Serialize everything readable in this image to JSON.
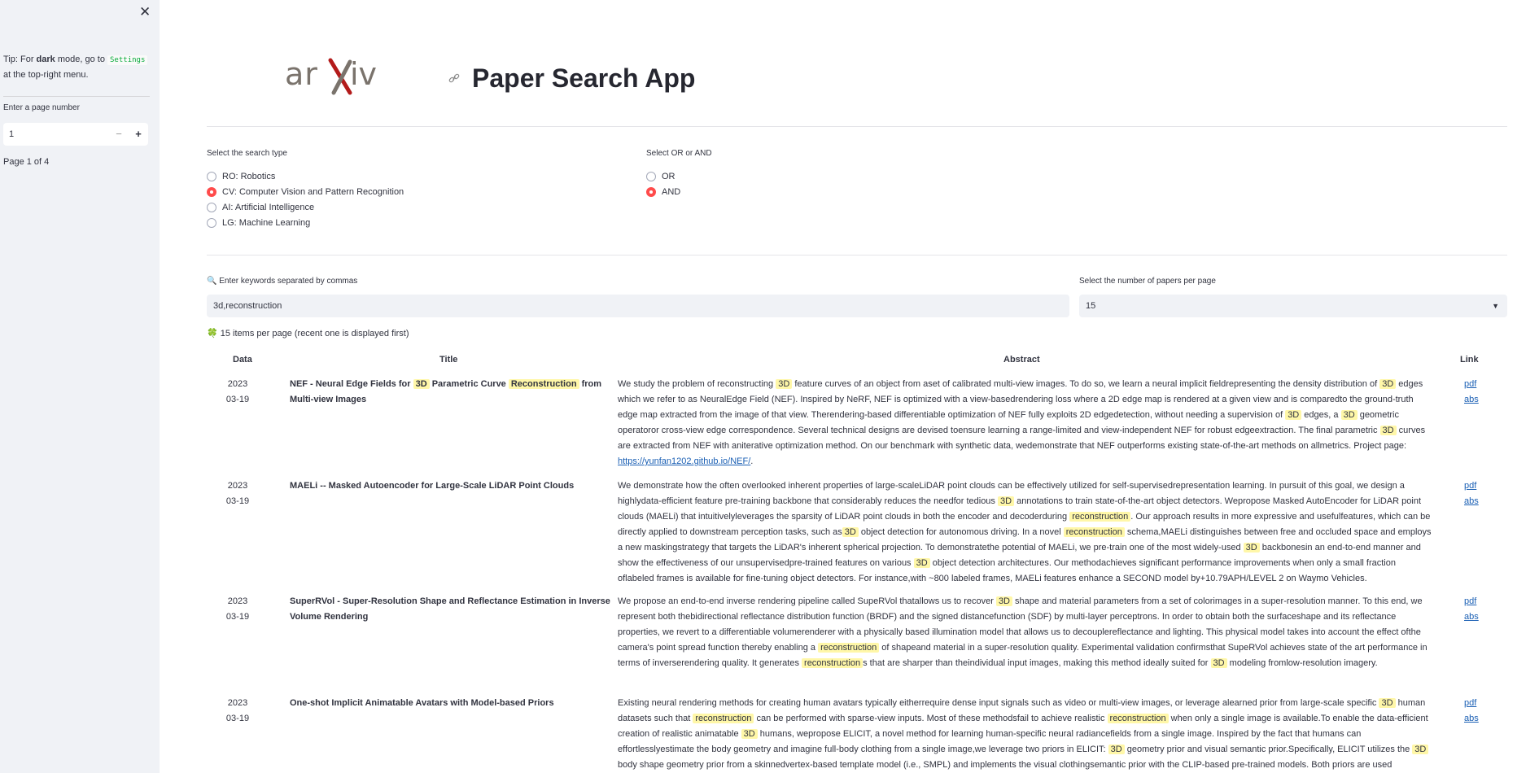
{
  "sidebar": {
    "close_glyph": "✕",
    "tip_prefix": "Tip: For ",
    "tip_bold": "dark",
    "tip_mid": " mode, go to ",
    "tip_code": "Settings",
    "tip_suffix": " at the top-right menu.",
    "page_label": "Enter a page number",
    "page_value": "1",
    "minus": "−",
    "plus": "+",
    "page_status": "Page 1 of 4"
  },
  "header": {
    "logo_text": "arXiv",
    "title": "Paper Search App"
  },
  "search_type": {
    "label": "Select the search type",
    "options": [
      "RO: Robotics",
      "CV: Computer Vision and Pattern Recognition",
      "AI: Artificial Intelligence",
      "LG: Machine Learning"
    ],
    "selected": "CV: Computer Vision and Pattern Recognition"
  },
  "logic": {
    "label": "Select OR or AND",
    "options": [
      "OR",
      "AND"
    ],
    "selected": "AND"
  },
  "keywords": {
    "label": "🔍 Enter keywords separated by commas",
    "value": "3d,reconstruction"
  },
  "per_page": {
    "label": "Select the number of papers per page",
    "value": "15"
  },
  "items_info": "🍀 15 items per page (recent one is displayed first)",
  "table": {
    "headers": {
      "date": "Data",
      "title": "Title",
      "abstract": "Abstract",
      "link": "Link"
    },
    "rows": [
      {
        "date_year": "2023",
        "date_md": "03-19",
        "title": [
          {
            "t": "NEF - Neural Edge Fields for "
          },
          {
            "t": "3D",
            "hl": true
          },
          {
            "t": " Parametric Curve "
          },
          {
            "t": "Reconstruction",
            "hl": true
          },
          {
            "t": " from Multi-view Images"
          }
        ],
        "abstract": [
          {
            "t": "We study the problem of reconstructing "
          },
          {
            "t": "3D",
            "hl": true
          },
          {
            "t": " feature curves of an object from aset of calibrated multi-view images. To do so, we learn a neural implicit fieldrepresenting the density distribution of "
          },
          {
            "t": "3D",
            "hl": true
          },
          {
            "t": " edges which we refer to as NeuralEdge Field (NEF). Inspired by NeRF, NEF is optimized with a view-basedrendering loss where a 2D edge map is rendered at a given view and is comparedto the ground-truth edge map extracted from the image of that view. Therendering-based differentiable optimization of NEF fully exploits 2D edgedetection, without needing a supervision of "
          },
          {
            "t": "3D",
            "hl": true
          },
          {
            "t": " edges, a "
          },
          {
            "t": "3D",
            "hl": true
          },
          {
            "t": " geometric operatoror cross-view edge correspondence. Several technical designs are devised toensure learning a range-limited and view-independent NEF for robust edgeextraction. The final parametric "
          },
          {
            "t": "3D",
            "hl": true
          },
          {
            "t": " curves are extracted from NEF with aniterative optimization method. On our benchmark with synthetic data, wedemonstrate that NEF outperforms existing state-of-the-art methods on allmetrics. Project page: "
          },
          {
            "t": "https://yunfan1202.github.io/NEF/",
            "url": true
          },
          {
            "t": "."
          }
        ],
        "pdf": "pdf",
        "abs": "abs"
      },
      {
        "date_year": "2023",
        "date_md": "03-19",
        "title": [
          {
            "t": "MAELi -- Masked Autoencoder for Large-Scale LiDAR Point Clouds"
          }
        ],
        "abstract": [
          {
            "t": "We demonstrate how the often overlooked inherent properties of large-scaleLiDAR point clouds can be effectively utilized for self-supervisedrepresentation learning. In pursuit of this goal, we design a highlydata-efficient feature pre-training backbone that considerably reduces the needfor tedious "
          },
          {
            "t": "3D",
            "hl": true
          },
          {
            "t": " annotations to train state-of-the-art object detectors. Wepropose Masked AutoEncoder for LiDAR point clouds (MAELi) that intuitivelyleverages the sparsity of LiDAR point clouds in both the encoder and decoderduring "
          },
          {
            "t": "reconstruction",
            "hl": true
          },
          {
            "t": ". Our approach results in more expressive and usefulfeatures, which can be directly applied to downstream perception tasks, such as"
          },
          {
            "t": "3D",
            "hl": true
          },
          {
            "t": " object detection for autonomous driving. In a novel "
          },
          {
            "t": "reconstruction",
            "hl": true
          },
          {
            "t": " schema,MAELi distinguishes between free and occluded space and employs a new maskingstrategy that targets the LiDAR's inherent spherical projection. To demonstratethe potential of MAELi, we pre-train one of the most widely-used "
          },
          {
            "t": "3D",
            "hl": true
          },
          {
            "t": " backbonesin an end-to-end manner and show the effectiveness of our unsupervisedpre-trained features on various "
          },
          {
            "t": "3D",
            "hl": true
          },
          {
            "t": " object detection architectures. Our methodachieves significant performance improvements when only a small fraction oflabeled frames is available for fine-tuning object detectors. For instance,with ~800 labeled frames, MAELi features enhance a SECOND model by+10.79APH/LEVEL 2 on Waymo Vehicles."
          }
        ],
        "pdf": "pdf",
        "abs": "abs"
      },
      {
        "date_year": "2023",
        "date_md": "03-19",
        "title": [
          {
            "t": "SuperRVol - Super-Resolution Shape and Reflectance Estimation in Inverse Volume Rendering"
          }
        ],
        "abstract": [
          {
            "t": "We propose an end-to-end inverse rendering pipeline called SupeRVol thatallows us to recover "
          },
          {
            "t": "3D",
            "hl": true
          },
          {
            "t": " shape and material parameters from a set of colorimages in a super-resolution manner. To this end, we represent both thebidirectional reflectance distribution function (BRDF) and the signed distancefunction (SDF) by multi-layer perceptrons. In order to obtain both the surfaceshape and its reflectance properties, we revert to a differentiable volumerenderer with a physically based illumination model that allows us to decouplereflectance and lighting. This physical model takes into account the effect ofthe camera's point spread function thereby enabling a "
          },
          {
            "t": "reconstruction",
            "hl": true
          },
          {
            "t": " of shapeand material in a super-resolution quality. Experimental validation confirmsthat SupeRVol achieves state of the art performance in terms of inverserendering quality. It generates "
          },
          {
            "t": "reconstruction",
            "hl": true
          },
          {
            "t": "s that are sharper than theindividual input images, making this method ideally suited for "
          },
          {
            "t": "3D",
            "hl": true
          },
          {
            "t": " modeling fromlow-resolution imagery."
          }
        ],
        "pdf": "pdf",
        "abs": "abs"
      },
      {
        "date_year": "2023",
        "date_md": "03-19",
        "title": [
          {
            "t": "One-shot Implicit Animatable Avatars with Model-based Priors"
          }
        ],
        "abstract": [
          {
            "t": "Existing neural rendering methods for creating human avatars typically eitherrequire dense input signals such as video or multi-view images, or leverage alearned prior from large-scale specific "
          },
          {
            "t": "3D",
            "hl": true
          },
          {
            "t": " human datasets such that "
          },
          {
            "t": "reconstruction",
            "hl": true
          },
          {
            "t": " can be performed with sparse-view inputs. Most of these methodsfail to achieve realistic "
          },
          {
            "t": "reconstruction",
            "hl": true
          },
          {
            "t": " when only a single image is available.To enable the data-efficient creation of realistic animatable "
          },
          {
            "t": "3D",
            "hl": true
          },
          {
            "t": " humans, wepropose ELICIT, a novel method for learning human-specific neural radiancefields from a single image. Inspired by the fact that humans can effortlesslyestimate the body geometry and imagine full-body clothing from a single image,we leverage two priors in ELICIT: "
          },
          {
            "t": "3D",
            "hl": true
          },
          {
            "t": " geometry prior and visual semantic prior.Specifically, ELICIT utilizes the "
          },
          {
            "t": "3D",
            "hl": true
          },
          {
            "t": " body shape geometry prior from a skinnedvertex-based template model (i.e., SMPL) and implements the visual clothingsemantic prior with the CLIP-based pre-trained models. Both priors are used"
          }
        ],
        "pdf": "pdf",
        "abs": "abs"
      }
    ]
  }
}
